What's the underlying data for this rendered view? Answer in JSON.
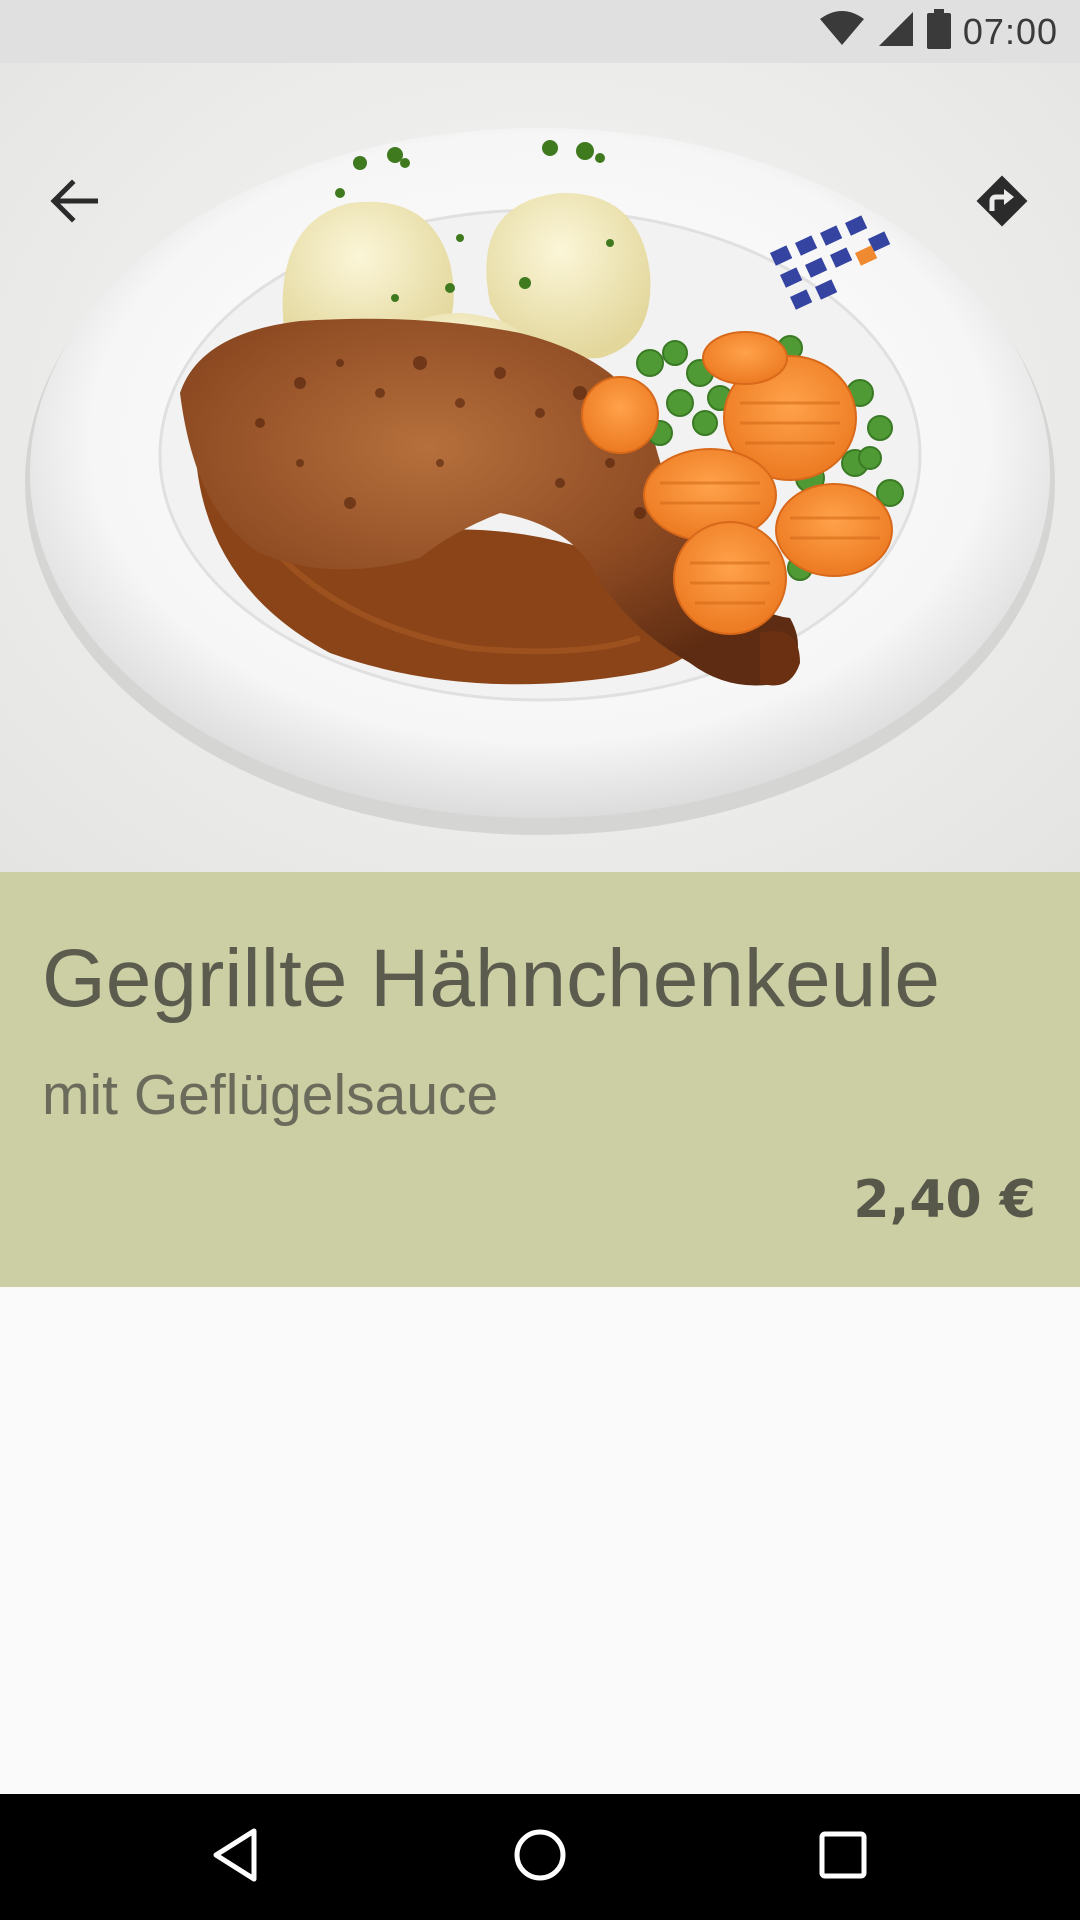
{
  "status_bar": {
    "time": "07:00",
    "icons": [
      "wifi-icon",
      "cell-signal-icon",
      "battery-icon"
    ]
  },
  "toolbar": {
    "back_icon": "arrow-back-icon",
    "directions_icon": "directions-icon"
  },
  "dish": {
    "title": "Gegrillte Hähnchenkeule",
    "subtitle": "mit Geflügelsauce",
    "price": "2,40 €"
  },
  "colors": {
    "info_background": "#cccea4",
    "status_bar": "#e0e0e0",
    "nav_bar": "#000000"
  },
  "nav_bar": {
    "icons": [
      "nav-back-icon",
      "nav-home-icon",
      "nav-recents-icon"
    ]
  }
}
